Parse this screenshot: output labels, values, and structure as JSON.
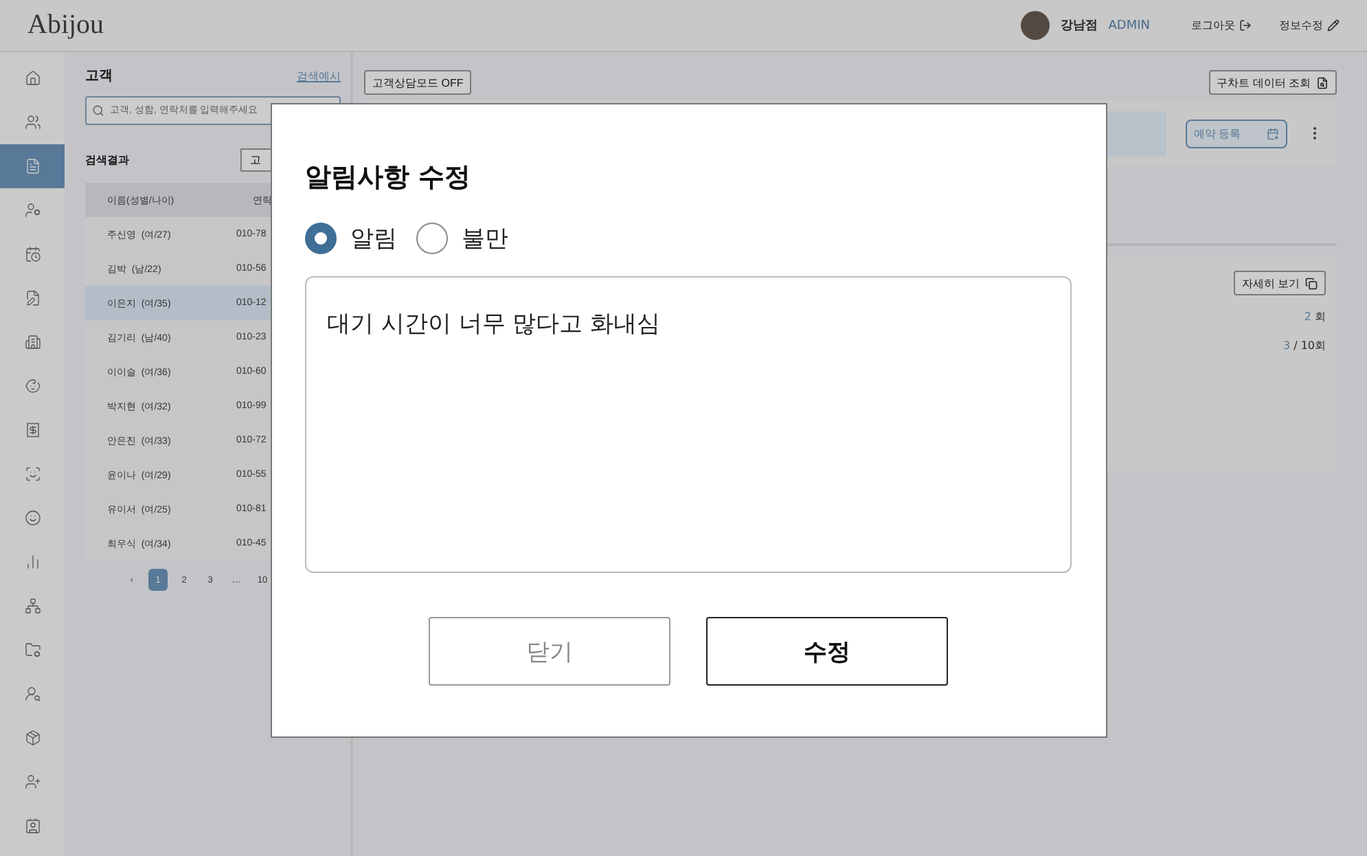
{
  "header": {
    "logo": "Abijou",
    "branch": "강남점",
    "role": "ADMIN",
    "logout": "로그아웃",
    "edit_profile": "정보수정"
  },
  "sidebar": {
    "items": [
      {
        "selected": false
      },
      {
        "selected": false
      },
      {
        "selected": true
      },
      {
        "selected": false
      },
      {
        "selected": false
      },
      {
        "selected": false
      },
      {
        "selected": false
      },
      {
        "selected": false
      },
      {
        "selected": false
      },
      {
        "selected": false
      },
      {
        "selected": false
      },
      {
        "selected": false
      },
      {
        "selected": false
      },
      {
        "selected": false
      },
      {
        "selected": false
      },
      {
        "selected": false
      },
      {
        "selected": false
      },
      {
        "selected": false
      }
    ]
  },
  "customers": {
    "title": "고객",
    "search_help": "검색예시",
    "search": {
      "placeholder": "고객, 성함, 연락처를 입력해주세요"
    },
    "results_label": "검색결과",
    "results_button": "고",
    "columns": [
      "이름(성별/나이)",
      "연락"
    ],
    "rows": [
      {
        "name": "주신영",
        "info": "(여/27)",
        "phone": "010-78",
        "selected": false
      },
      {
        "name": "김박",
        "info": "(남/22)",
        "phone": "010-56",
        "selected": false
      },
      {
        "name": "이은지",
        "info": "(여/35)",
        "phone": "010-12",
        "selected": true
      },
      {
        "name": "김기리",
        "info": "(남/40)",
        "phone": "010-23",
        "selected": false
      },
      {
        "name": "이이슬",
        "info": "(여/36)",
        "phone": "010-60",
        "selected": false
      },
      {
        "name": "박지현",
        "info": "(여/32)",
        "phone": "010-99",
        "selected": false
      },
      {
        "name": "안은진",
        "info": "(여/33)",
        "phone": "010-72",
        "selected": false
      },
      {
        "name": "윤이나",
        "info": "(여/29)",
        "phone": "010-55",
        "selected": false
      },
      {
        "name": "유이서",
        "info": "(여/25)",
        "phone": "010-81",
        "selected": false
      },
      {
        "name": "최우식",
        "info": "(여/34)",
        "phone": "010-45",
        "selected": false
      }
    ],
    "pagination": {
      "prev": "‹",
      "pages": [
        {
          "label": "1",
          "selected": true
        },
        {
          "label": "2",
          "selected": false
        },
        {
          "label": "3",
          "selected": false
        },
        {
          "label": "…",
          "selected": false
        },
        {
          "label": "10",
          "selected": false
        }
      ]
    }
  },
  "main": {
    "consult_mode": "고객상담모드 OFF",
    "old_chart": "구차트 데이터 조회",
    "reserve": "예약 등록",
    "details": "자세히 보기",
    "stats": [
      {
        "count": "2",
        "unit": "회"
      },
      {
        "count": "3",
        "unit": "/ 10회"
      }
    ]
  },
  "modal": {
    "title": "알림사항 수정",
    "options": [
      {
        "label": "알림",
        "selected": true
      },
      {
        "label": "불만",
        "selected": false
      }
    ],
    "text": "대기 시간이 너무 많다고 화내심",
    "buttons": [
      {
        "label": "닫기",
        "kind": "secondary"
      },
      {
        "label": "수정",
        "kind": "primary"
      }
    ]
  }
}
